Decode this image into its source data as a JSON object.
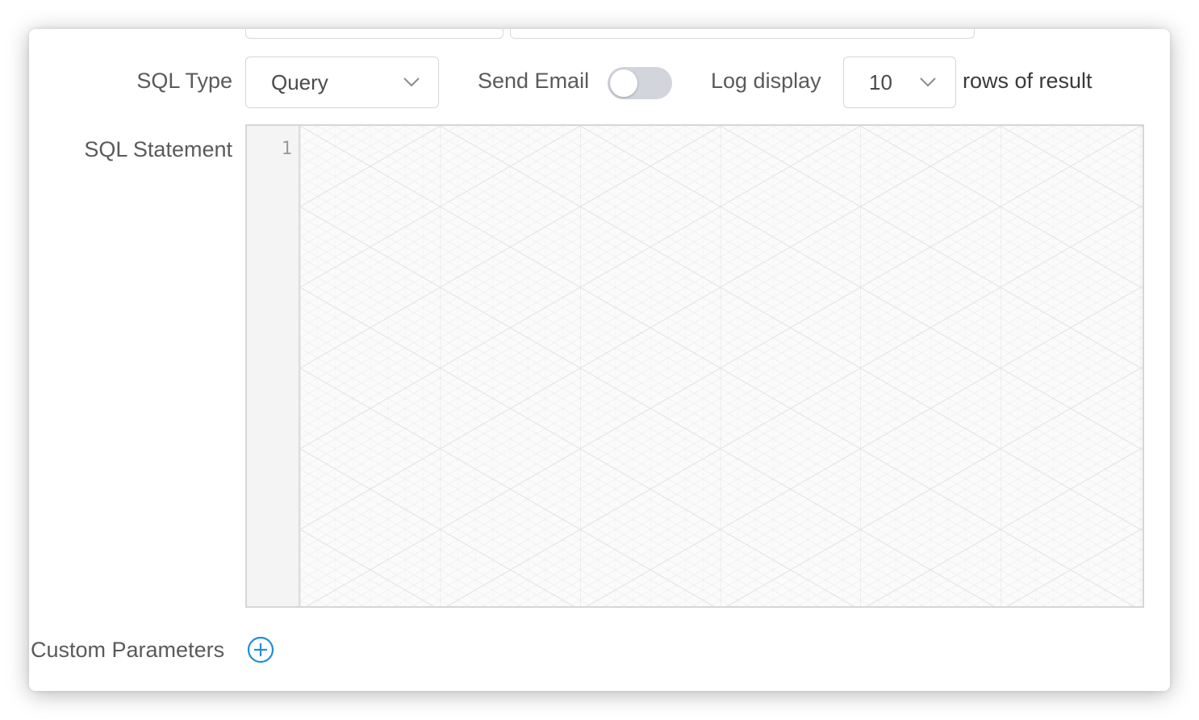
{
  "form": {
    "sql_type": {
      "label": "SQL Type",
      "selected": "Query"
    },
    "send_email": {
      "label": "Send Email",
      "enabled": false
    },
    "log_display": {
      "label": "Log display",
      "selected": "10",
      "suffix": "rows of result"
    },
    "sql_statement": {
      "label": "SQL Statement",
      "line_numbers": [
        "1"
      ],
      "content": ""
    },
    "custom_parameters": {
      "label": "Custom Parameters"
    }
  },
  "icons": {
    "chevron": "chevron-down-icon",
    "add": "plus-circle-icon"
  },
  "colors": {
    "accent": "#1f8ed9",
    "label_text": "#5a5a5a",
    "toggle_off": "#d3d5dd",
    "border": "#d6d6dc"
  }
}
